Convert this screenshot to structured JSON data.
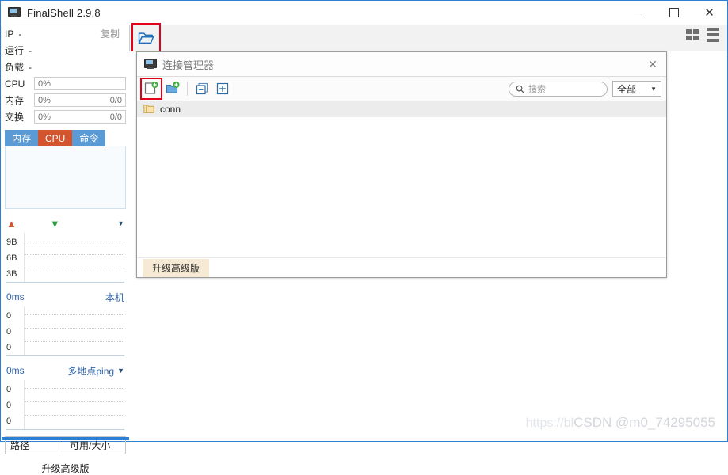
{
  "window": {
    "title": "FinalShell 2.9.8",
    "icon": "monitor-icon",
    "minimize_label": "—",
    "maximize_label": "□",
    "close_label": "✕"
  },
  "toolbar": {
    "open_icon": "folder-open-icon",
    "grid_view_icon": "grid-view-icon",
    "list_view_icon": "list-view-icon"
  },
  "sidebar": {
    "ip": {
      "label": "IP",
      "value": "-",
      "copy": "复制"
    },
    "uptime": {
      "label": "运行",
      "value": "-"
    },
    "load": {
      "label": "负载",
      "value": "-"
    },
    "meters": [
      {
        "label": "CPU",
        "percent": "0%",
        "ratio": ""
      },
      {
        "label": "内存",
        "percent": "0%",
        "ratio": "0/0"
      },
      {
        "label": "交换",
        "percent": "0%",
        "ratio": "0/0"
      }
    ],
    "tabs": [
      {
        "label": "内存",
        "active": false
      },
      {
        "label": "CPU",
        "active": true
      },
      {
        "label": "命令",
        "active": false
      }
    ],
    "net_graph": {
      "up_icon": "upload-arrow-icon",
      "down_icon": "download-arrow-icon",
      "dropdown_icon": "chevron-down-icon",
      "y_ticks": [
        "9B",
        "6B",
        "3B"
      ]
    },
    "ping_graph": {
      "value": "0ms",
      "mode": "本机",
      "y_ticks": [
        "0",
        "0",
        "0"
      ]
    },
    "multiping_graph": {
      "value": "0ms",
      "mode": "多地点ping",
      "dropdown_icon": "chevron-down-icon",
      "y_ticks": [
        "0",
        "0",
        "0"
      ]
    },
    "disk_header": {
      "path": "路径",
      "size": "可用/大小"
    },
    "upgrade_link": "升级高级版"
  },
  "dialog": {
    "title": "连接管理器",
    "icon": "monitor-icon",
    "close_label": "✕",
    "toolbar": {
      "new_connection": "new-connection-icon",
      "new_folder": "new-folder-icon",
      "collapse_all": "collapse-all-icon",
      "expand_all": "expand-all-icon"
    },
    "search": {
      "placeholder": "搜索",
      "value": "",
      "icon": "search-icon"
    },
    "filter": {
      "selected": "全部",
      "icon": "chevron-down-icon"
    },
    "tree": [
      {
        "label": "conn",
        "icon": "folder-icon",
        "selected": true
      }
    ],
    "upgrade_button": "升级高级版"
  },
  "watermark": {
    "url": "https://bl",
    "text": "CSDN @m0_74295055"
  },
  "colors": {
    "accent": "#2b7fd4",
    "tab_blue": "#5b9bd5",
    "tab_active": "#d2552f",
    "highlight_red": "#e2001a"
  }
}
